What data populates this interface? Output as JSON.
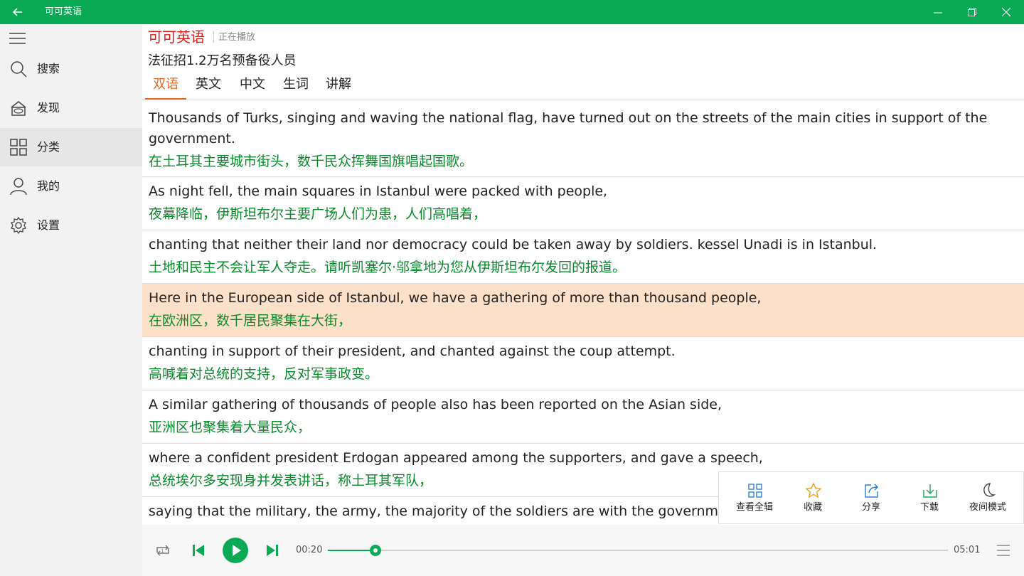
{
  "window": {
    "title": "可可英语",
    "colors": {
      "titlebar": "#0aaa55",
      "brand": "#e21b1b",
      "accent": "#e86a2a",
      "chinese_text": "#0a8a2a",
      "highlight": "#fde0c8"
    }
  },
  "sidebar": {
    "menu_icon": "hamburger-icon",
    "items": [
      {
        "label": "搜索",
        "icon": "search-icon"
      },
      {
        "label": "发现",
        "icon": "discover-icon"
      },
      {
        "label": "分类",
        "icon": "grid-icon",
        "active": true
      },
      {
        "label": "我的",
        "icon": "user-icon"
      },
      {
        "label": "设置",
        "icon": "gear-icon"
      }
    ]
  },
  "header": {
    "brand": "可可英语",
    "status": "正在播放",
    "article_title": "法征招1.2万名预备役人员"
  },
  "tabs": [
    {
      "label": "双语",
      "active": true
    },
    {
      "label": "英文"
    },
    {
      "label": "中文"
    },
    {
      "label": "生词"
    },
    {
      "label": "讲解"
    }
  ],
  "sentences": [
    {
      "en": "Thousands of Turks, singing and waving the national flag, have turned out on the streets of the main cities in support of the government.",
      "cn": "在土耳其主要城市街头，数千民众挥舞国旗唱起国歌。"
    },
    {
      "en": "As night fell, the main squares in Istanbul were packed with people,",
      "cn": "夜幕降临，伊斯坦布尔主要广场人们为患，人们高唱着，"
    },
    {
      "en": "chanting that neither their land nor democracy could be taken away by soldiers. kessel Unadi is in Istanbul.",
      "cn": "土地和民主不会让军人夺走。请听凯塞尔·邬拿地为您从伊斯坦布尔发回的报道。"
    },
    {
      "en": "Here in the European side of Istanbul, we have a gathering of more than thousand people,",
      "cn": "在欧洲区，数千居民聚集在大街，",
      "highlighted": true
    },
    {
      "en": "chanting in support of their president, and chanted against the coup attempt.",
      "cn": "高喊着对总统的支持，反对军事政变。"
    },
    {
      "en": "A similar gathering of thousands of people also has been reported on the Asian side,",
      "cn": "亚洲区也聚集着大量民众，"
    },
    {
      "en": "where a confident president Erdogan appeared among the supporters, and gave a speech,",
      "cn": "总统埃尔多安现身并发表讲话，称土耳其军队，"
    },
    {
      "en": "saying that the military, the army, the majority of the soldiers are with the government",
      "cn": ""
    }
  ],
  "actions": [
    {
      "label": "查看全辑",
      "icon": "album-grid-icon"
    },
    {
      "label": "收藏",
      "icon": "star-icon"
    },
    {
      "label": "分享",
      "icon": "share-icon"
    },
    {
      "label": "下载",
      "icon": "download-icon"
    },
    {
      "label": "夜间模式",
      "icon": "moon-icon"
    }
  ],
  "player": {
    "current_time": "00:20",
    "total_time": "05:01",
    "progress": 0.077,
    "repeat_icon": "repeat-one-icon",
    "prev_icon": "previous-icon",
    "play_icon": "play-icon",
    "next_icon": "next-icon",
    "playlist_icon": "playlist-icon"
  }
}
